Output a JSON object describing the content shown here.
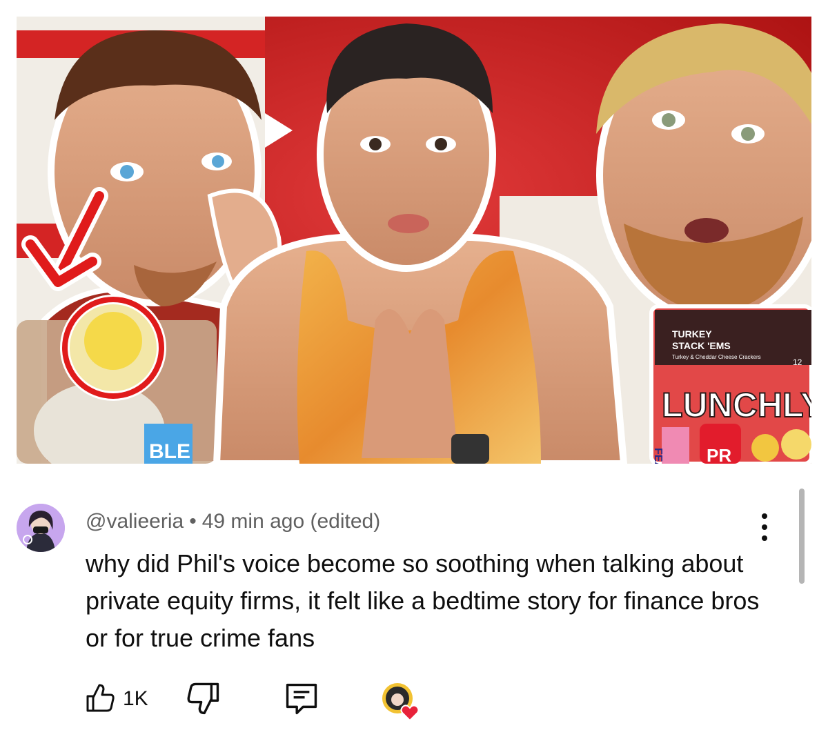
{
  "video": {
    "thumbnail": {
      "package_brand": "LUNCHLY",
      "package_label_line1": "TURKEY",
      "package_label_line2": "STACK 'EMS",
      "package_label_line3": "Turkey & Cheddar Cheese Crackers",
      "package_number": "12",
      "drink_label": "PR",
      "candy_label": "FEAS",
      "left_candy_label": "BLE"
    }
  },
  "comment": {
    "author": "@valieeria",
    "separator": "•",
    "time": "49 min ago (edited)",
    "text": "why did Phil's voice become so soothing when talking about private equity firms, it felt like a bedtime story for finance bros or for true crime fans",
    "likes": "1K"
  },
  "icons": {
    "avatar": "user-avatar-icon",
    "more": "more-vertical-icon",
    "like": "thumbs-up-icon",
    "dislike": "thumbs-down-icon",
    "reply": "reply-comment-icon",
    "creator_heart": "creator-heart-icon"
  },
  "colors": {
    "thumbnail_red": "#c41e1e",
    "text_primary": "#0f0f0f",
    "text_secondary": "#606060",
    "heart": "#e8223a",
    "avatar_bg": "#c7a6ee"
  }
}
